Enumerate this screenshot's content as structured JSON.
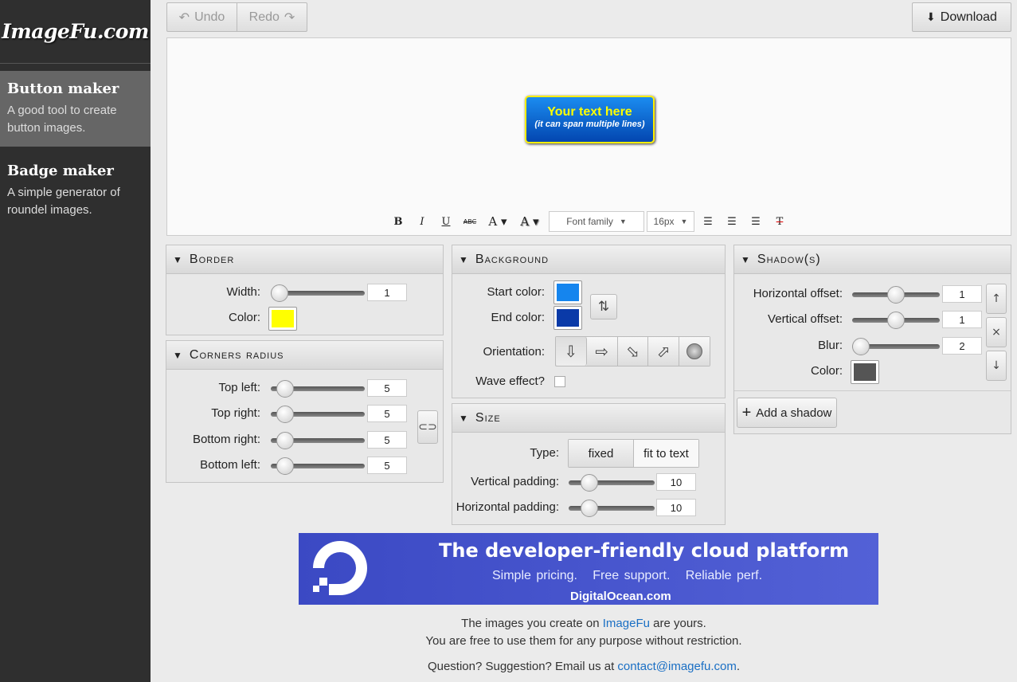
{
  "sidebar": {
    "logo": "ImageFu.com",
    "tools": [
      {
        "title": "Button maker",
        "desc": "A good tool to create button images."
      },
      {
        "title": "Badge maker",
        "desc": "A simple generator of roundel images."
      }
    ]
  },
  "toolbar": {
    "undo": "Undo",
    "redo": "Redo",
    "download": "Download"
  },
  "preview": {
    "line1": "Your text here",
    "line2": "(it can span multiple lines)",
    "border_color": "#ffee00",
    "start_color": "#1b8cf0",
    "end_color": "#0346b0"
  },
  "textbar": {
    "bold": "B",
    "italic": "I",
    "underline": "U",
    "strike": "ABC",
    "font_family": "Font family",
    "font_size": "16px"
  },
  "border": {
    "title": "Border",
    "width_label": "Width:",
    "width": "1",
    "color_label": "Color:",
    "color": "#ffff00"
  },
  "corners": {
    "title": "Corners radius",
    "top_left_label": "Top left:",
    "top_left": "5",
    "top_right_label": "Top right:",
    "top_right": "5",
    "bottom_right_label": "Bottom right:",
    "bottom_right": "5",
    "bottom_left_label": "Bottom left:",
    "bottom_left": "5"
  },
  "background": {
    "title": "Background",
    "start_label": "Start color:",
    "start_color": "#1585ee",
    "end_label": "End color:",
    "end_color": "#0a3aa8",
    "orientation_label": "Orientation:",
    "wave_label": "Wave effect?"
  },
  "size": {
    "title": "Size",
    "type_label": "Type:",
    "type_fixed": "fixed",
    "type_fit": "fit to text",
    "vpad_label": "Vertical padding:",
    "vpad": "10",
    "hpad_label": "Horizontal padding:",
    "hpad": "10"
  },
  "shadow": {
    "title": "Shadow(s)",
    "hoff_label": "Horizontal offset:",
    "hoff": "1",
    "voff_label": "Vertical offset:",
    "voff": "1",
    "blur_label": "Blur:",
    "blur": "2",
    "color_label": "Color:",
    "color": "#555555",
    "add": "Add a shadow"
  },
  "ad": {
    "headline": "The developer-friendly cloud platform",
    "sub": "Simple pricing.   Free support.   Reliable perf.",
    "domain": "DigitalOcean.com"
  },
  "footer": {
    "line1_a": "The images you create on ",
    "line1_link": "ImageFu",
    "line1_b": " are yours.",
    "line2": "You are free to use them for any purpose without restriction.",
    "line3_a": "Question? Suggestion? Email us at ",
    "line3_link": "contact@imagefu.com",
    "line3_b": "."
  }
}
